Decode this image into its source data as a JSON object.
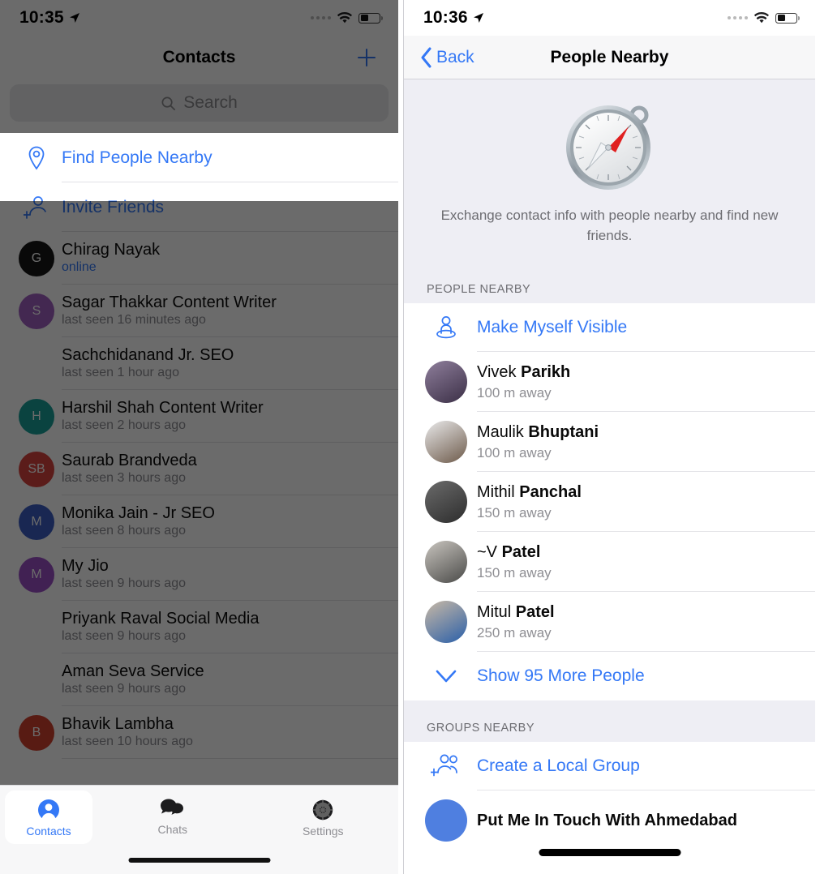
{
  "left": {
    "status": {
      "time": "10:35",
      "location_icon": "location-arrow-icon",
      "wifi_icon": "wifi-icon",
      "battery_icon": "battery-icon"
    },
    "navbar": {
      "title": "Contacts",
      "add_icon": "plus-icon"
    },
    "search": {
      "placeholder": "Search",
      "icon": "search-icon"
    },
    "actions": [
      {
        "label": "Find People Nearby",
        "icon": "map-pin-icon",
        "highlighted": true
      },
      {
        "label": "Invite Friends",
        "icon": "person-add-icon",
        "highlighted": false
      }
    ],
    "contacts": [
      {
        "name": "Chirag Nayak",
        "status": "online",
        "online": true,
        "initials": "G",
        "color": "#171717"
      },
      {
        "name": "Sagar Thakkar Content Writer",
        "status": "last seen 16 minutes ago",
        "online": false,
        "initials": "S",
        "color": "#a05fc0"
      },
      {
        "name": "Sachchidanand Jr. SEO",
        "status": "last seen 1 hour ago",
        "online": false,
        "initials": "",
        "color": ""
      },
      {
        "name": "Harshil Shah Content Writer",
        "status": "last seen 2 hours ago",
        "online": false,
        "initials": "H",
        "color": "#1aa199"
      },
      {
        "name": "Saurab Brandveda",
        "status": "last seen 3 hours ago",
        "online": false,
        "initials": "SB",
        "color": "#d9443f"
      },
      {
        "name": "Monika Jain - Jr SEO",
        "status": "last seen 8 hours ago",
        "online": false,
        "initials": "M",
        "color": "#3d5ec4"
      },
      {
        "name": "My Jio",
        "status": "last seen 9 hours ago",
        "online": false,
        "initials": "M",
        "color": "#9b4fc7"
      },
      {
        "name": "Priyank Raval Social Media",
        "status": "last seen 9 hours ago",
        "online": false,
        "initials": "",
        "color": ""
      },
      {
        "name": "Aman Seva Service",
        "status": "last seen 9 hours ago",
        "online": false,
        "initials": "",
        "color": ""
      },
      {
        "name": "Bhavik Lambha",
        "status": "last seen 10 hours ago",
        "online": false,
        "initials": "B",
        "color": "#d1402f"
      }
    ],
    "tabs": [
      {
        "label": "Contacts",
        "icon": "person-circle-icon",
        "active": true
      },
      {
        "label": "Chats",
        "icon": "chat-bubbles-icon",
        "active": false
      },
      {
        "label": "Settings",
        "icon": "gear-icon",
        "active": false
      }
    ]
  },
  "right": {
    "status": {
      "time": "10:36",
      "location_icon": "location-arrow-icon",
      "wifi_icon": "wifi-icon",
      "battery_icon": "battery-icon"
    },
    "navbar": {
      "back_label": "Back",
      "back_icon": "chevron-left-icon",
      "title": "People Nearby"
    },
    "hero": {
      "icon": "compass-icon",
      "description": "Exchange contact info with people nearby and find new friends."
    },
    "people_section": {
      "header": "PEOPLE NEARBY",
      "action": {
        "label": "Make Myself Visible",
        "icon": "person-visible-icon"
      },
      "people": [
        {
          "first": "Vivek",
          "last": "Parikh",
          "distance": "100 m away",
          "avatar_colors": [
            "#8f7f9c",
            "#3b2f46"
          ]
        },
        {
          "first": "Maulik",
          "last": "Bhuptani",
          "distance": "100 m away",
          "avatar_colors": [
            "#e9e9ea",
            "#6d5a4a"
          ]
        },
        {
          "first": "Mithil",
          "last": "Panchal",
          "distance": "150 m away",
          "avatar_colors": [
            "#6b6b6b",
            "#2d2d2d"
          ]
        },
        {
          "first": "~V",
          "last": "Patel",
          "distance": "150 m away",
          "avatar_colors": [
            "#c9c5bf",
            "#4a4a48"
          ]
        },
        {
          "first": "Mitul",
          "last": "Patel",
          "distance": "250 m away",
          "avatar_colors": [
            "#c9b9a6",
            "#2a5fa8"
          ]
        }
      ],
      "show_more": {
        "label": "Show 95 More People",
        "icon": "chevron-down-icon"
      }
    },
    "groups_section": {
      "header": "GROUPS NEARBY",
      "action": {
        "label": "Create a Local Group",
        "icon": "people-add-icon"
      },
      "groups": [
        {
          "name": "Put Me In Touch With Ahmedabad",
          "color": "#4f7fe0"
        }
      ]
    }
  },
  "colors": {
    "accent": "#3478f6",
    "secondary_text": "#8e8e93",
    "panel_bg": "#eeeef4"
  }
}
